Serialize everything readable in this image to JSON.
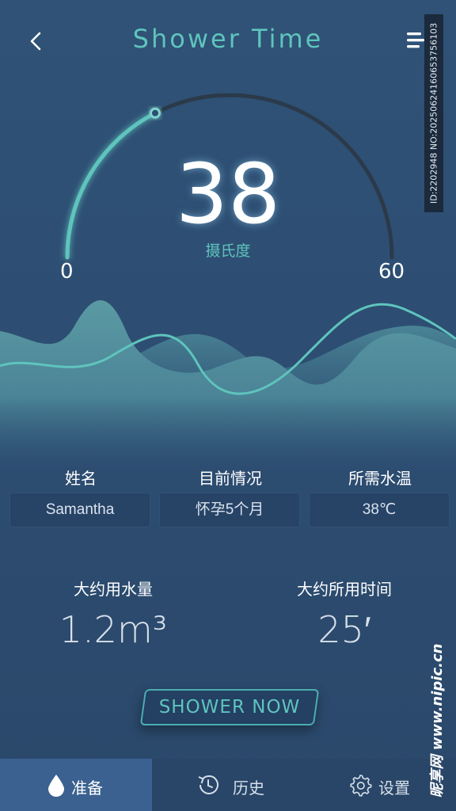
{
  "header": {
    "title": "Shower  Time",
    "back_icon": "chevron-left-icon",
    "menu_icon": "menu-icon"
  },
  "gauge": {
    "value": "38",
    "unit": "摄氏度",
    "min": "0",
    "max": "60",
    "level": 38,
    "range": [
      0,
      60
    ],
    "active_color": "#5fc4bd",
    "track_color": "#2b3a4a"
  },
  "fields": [
    {
      "label": "姓名",
      "value": "Samantha"
    },
    {
      "label": "目前情况",
      "value": "怀孕5个月"
    },
    {
      "label": "所需水温",
      "value": "38℃"
    }
  ],
  "stats": [
    {
      "label": "大约用水量",
      "value": "1.2m³"
    },
    {
      "label": "大约所用时间",
      "value": "25′"
    }
  ],
  "action": {
    "label": "SHOWER NOW"
  },
  "nav": [
    {
      "label": "准备",
      "icon": "water-drop-icon",
      "active": true
    },
    {
      "label": "历史",
      "icon": "history-clock-icon",
      "active": false
    },
    {
      "label": "设置",
      "icon": "gear-icon",
      "active": false
    }
  ],
  "watermark": {
    "id_text": "ID:2202948 NO:20250624160653756103",
    "site_text": "昵享网 www.nipic.cn"
  },
  "colors": {
    "accent": "#5fc4bd",
    "background": "#2d4d70",
    "field_bg": "#274366",
    "nav_active": "#3a6190"
  }
}
